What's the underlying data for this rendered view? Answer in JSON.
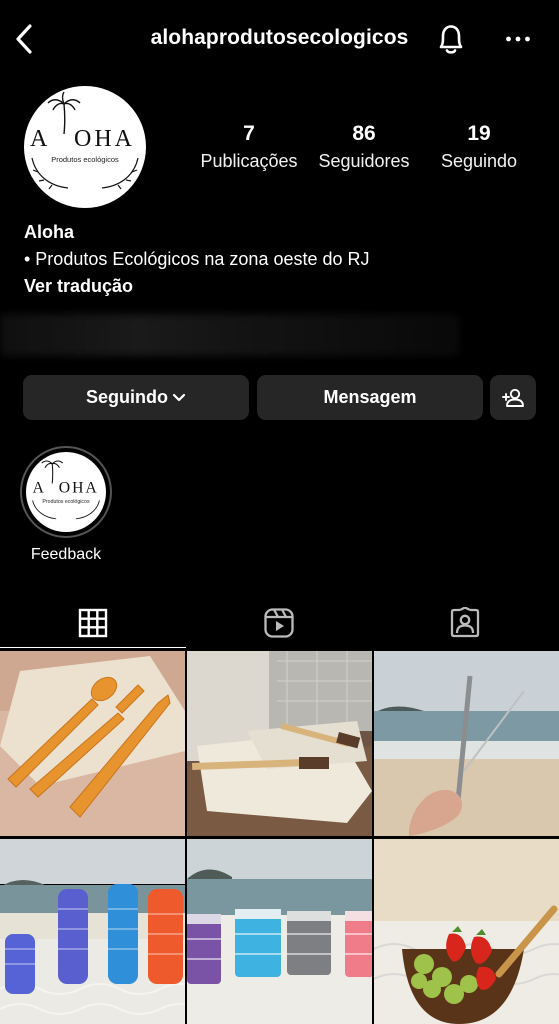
{
  "header": {
    "username": "alohaprodutosecologicos"
  },
  "brand": {
    "logo_text_left": "A",
    "logo_text_right": "OHA",
    "logo_subtitle": "Produtos ecológicos"
  },
  "stats": {
    "posts_count": "7",
    "posts_label": "Publicações",
    "followers_count": "86",
    "followers_label": "Seguidores",
    "following_count": "19",
    "following_label": "Seguindo"
  },
  "bio": {
    "name": "Aloha",
    "description": "• Produtos Ecológicos na zona oeste do RJ",
    "translate": "Ver tradução"
  },
  "actions": {
    "following_label": "Seguindo",
    "message_label": "Mensagem"
  },
  "highlights": [
    {
      "label": "Feedback"
    }
  ],
  "tabs": {
    "grid_icon": "grid-icon",
    "reels_icon": "reels-icon",
    "tagged_icon": "tagged-icon"
  },
  "colors": {
    "background": "#000000",
    "button": "#262626",
    "text": "#ffffff"
  }
}
